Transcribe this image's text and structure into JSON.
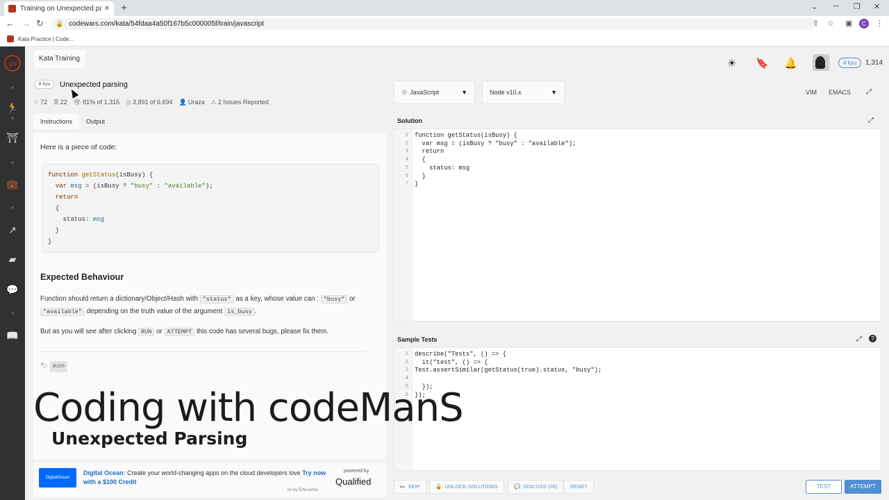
{
  "browser": {
    "tab_title": "Training on Unexpected parsing | C",
    "tab_close": "✕",
    "new_tab": "+",
    "url": "codewars.com/kata/54fdaa4a50f167b5c000005f/train/javascript",
    "bookmark_label": "Kata Practice | Code...",
    "profile_initial": "C"
  },
  "header": {
    "kata_training": "Kata Training",
    "rank": "4 kyu",
    "honor": "1,314"
  },
  "kata": {
    "kyu": "8 kyu",
    "title": "Unexpected parsing",
    "stars": "72",
    "collections": "22",
    "satisfaction": "81% of 1,315",
    "completed": "3,891 of 6,694",
    "author": "Uraza",
    "issues": "2 Issues Reported"
  },
  "tabs": {
    "instructions": "Instructions",
    "output": "Output"
  },
  "instructions": {
    "intro": "Here is a piece of code:",
    "code": [
      "function getStatus(isBusy) {",
      "  var msg = (isBusy ? \"busy\" : \"available\");",
      "  return",
      "  {",
      "    status: msg",
      "  }",
      "}"
    ],
    "heading": "Expected Behaviour",
    "p1_a": "Function should return a dictionary/Object/Hash with ",
    "p1_code1": "\"status\"",
    "p1_b": " as a key, whose value can : ",
    "p1_code2": "\"busy\"",
    "p1_c": " or ",
    "p1_code3": "\"available\"",
    "p1_d": " depending on the truth value of the argument ",
    "p1_code4": "is_busy",
    "p1_e": ".",
    "p2_a": "But as you will see after clicking ",
    "p2_code1": "RUN",
    "p2_b": " or ",
    "p2_code2": "ATTEMPT",
    "p2_c": " this code has several bugs, please fix them.",
    "tag": "BUGS"
  },
  "ad": {
    "logo": "DigitalOcean",
    "brand": "Digital Ocean:",
    "text": " Create your world-changing apps on the cloud developers love ",
    "cta": "Try now with a $100 Credit",
    "small": "Ad by EthicalAds",
    "powered": "powered by",
    "qualified": "Qualified"
  },
  "editor": {
    "language": "JavaScript",
    "version": "Node v10.x",
    "vim": "VIM",
    "emacs": "EMACS",
    "solution_title": "Solution",
    "solution_lines": [
      "function getStatus(isBusy) {",
      "  var msg = (isBusy ? \"busy\" : \"available\");",
      "  return",
      "  {",
      "    status: msg",
      "  }",
      "}"
    ],
    "tests_title": "Sample Tests",
    "test_lines": [
      "describe(\"Tests\", () => {",
      "  it(\"test\", () => {",
      "Test.assertSimilar(getStatus(true).status, \"busy\");",
      "",
      "  });",
      "});"
    ]
  },
  "buttons": {
    "skip": "SKIP",
    "unlock": "UNLOCK SOLUTIONS",
    "discuss": "DISCUSS (28)",
    "reset": "RESET",
    "test": "TEST",
    "attempt": "ATTEMPT"
  },
  "overlay": {
    "title": "Coding with codeManS",
    "subtitle": "Unexpected Parsing"
  },
  "colors": {
    "accent": "#4f8ed1",
    "brand": "#b1361e",
    "sidebar": "#303133"
  },
  "icons": [
    "search-icon",
    "star-icon",
    "bell-icon",
    "bookmark-icon",
    "sun-icon",
    "expand-icon",
    "help-icon",
    "tag-icon"
  ]
}
